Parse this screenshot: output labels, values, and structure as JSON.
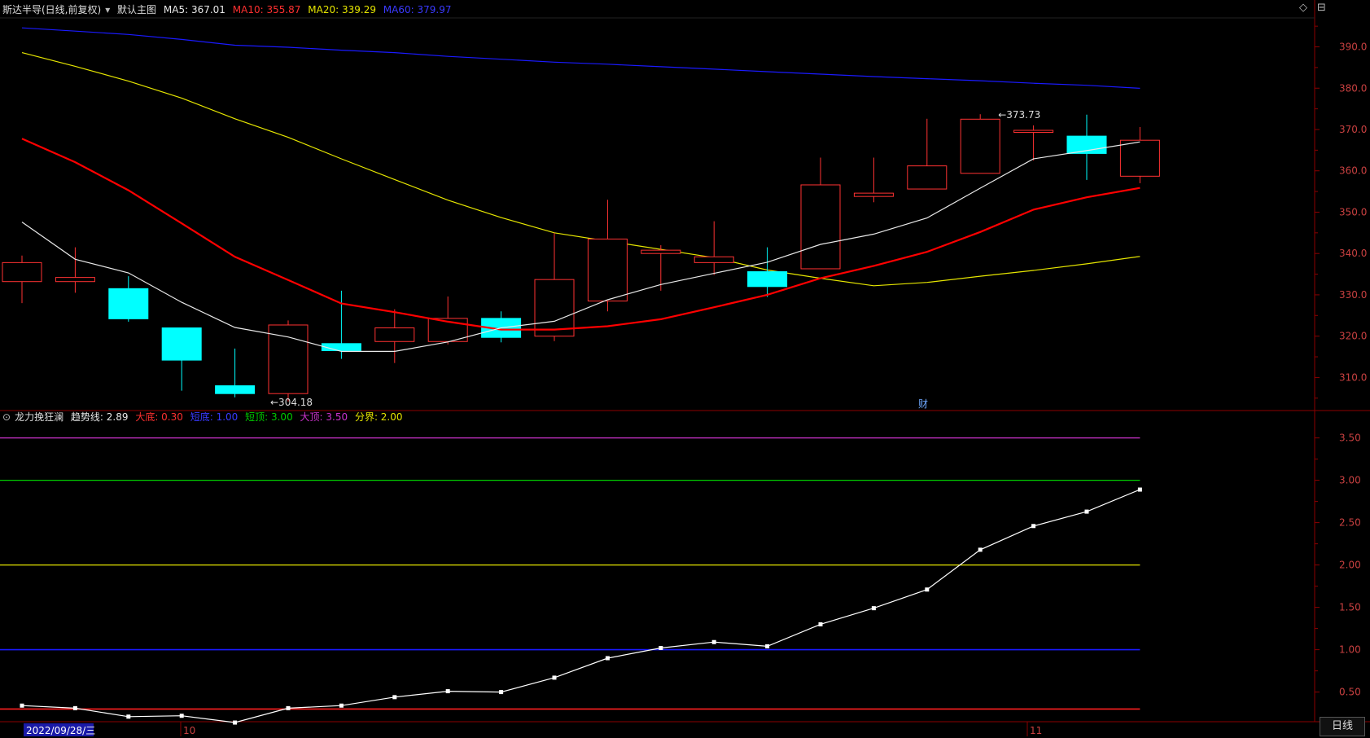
{
  "colors": {
    "up": "#ff3232",
    "down": "#00ffff",
    "ma5": "#e8e8e8",
    "ma10": "#ff0000",
    "ma20": "#e5e500",
    "ma60": "#1a1aff",
    "frame": "#8b0000",
    "axis_text": "#c84040",
    "trend": "#ffffff"
  },
  "main_header": {
    "title": "斯达半导(日线,前复权)",
    "mode": "默认主图",
    "ma5": "MA5: 367.01",
    "ma10": "MA10: 355.87",
    "ma20": "MA20: 339.29",
    "ma60": "MA60: 379.97"
  },
  "sub_header": {
    "title": "龙力挽狂澜",
    "trend": "趋势线: 2.89",
    "bottom": "大底: 0.30",
    "short_bottom": "短底: 1.00",
    "short_top": "短顶: 3.00",
    "top": "大顶: 3.50",
    "divide": "分界: 2.00"
  },
  "top_controls": {
    "diamond": "◇",
    "minimize": "⊟"
  },
  "annotations": {
    "high": "373.73",
    "low": "304.18",
    "finance": "财"
  },
  "date_axis": {
    "cursor_date": "2022/09/28/三",
    "month_10": "10",
    "month_11": "11"
  },
  "period_button": "日线",
  "chart_data": [
    {
      "type": "candlestick",
      "yticks": [
        310,
        320,
        330,
        340,
        350,
        360,
        370,
        380,
        390
      ],
      "ylim": [
        302,
        397
      ],
      "candles": [
        {
          "open": 333.2,
          "high": 339.5,
          "low": 328.0,
          "close": 337.8
        },
        {
          "open": 333.2,
          "high": 341.5,
          "low": 330.5,
          "close": 334.2
        },
        {
          "open": 331.5,
          "high": 334.5,
          "low": 323.5,
          "close": 324.2
        },
        {
          "open": 322.0,
          "high": 322.0,
          "low": 306.8,
          "close": 314.2
        },
        {
          "open": 308.0,
          "high": 317.0,
          "low": 305.2,
          "close": 306.1
        },
        {
          "open": 306.1,
          "high": 323.8,
          "low": 304.2,
          "close": 322.7
        },
        {
          "open": 318.2,
          "high": 331.0,
          "low": 314.5,
          "close": 316.5
        },
        {
          "open": 318.7,
          "high": 326.5,
          "low": 313.5,
          "close": 322.0
        },
        {
          "open": 318.7,
          "high": 329.6,
          "low": 318.0,
          "close": 324.3
        },
        {
          "open": 324.3,
          "high": 326.0,
          "low": 318.5,
          "close": 319.7
        },
        {
          "open": 320.0,
          "high": 345.0,
          "low": 318.8,
          "close": 333.7
        },
        {
          "open": 328.5,
          "high": 353.0,
          "low": 326.0,
          "close": 343.5
        },
        {
          "open": 340.0,
          "high": 342.0,
          "low": 331.0,
          "close": 340.8
        },
        {
          "open": 337.8,
          "high": 347.8,
          "low": 334.8,
          "close": 339.2
        },
        {
          "open": 335.6,
          "high": 341.5,
          "low": 329.5,
          "close": 332.0
        },
        {
          "open": 336.3,
          "high": 363.2,
          "low": 336.3,
          "close": 356.6
        },
        {
          "open": 353.8,
          "high": 363.2,
          "low": 352.4,
          "close": 354.6
        },
        {
          "open": 355.6,
          "high": 372.6,
          "low": 355.6,
          "close": 361.2
        },
        {
          "open": 359.4,
          "high": 373.7,
          "low": 359.4,
          "close": 372.5
        },
        {
          "open": 369.3,
          "high": 371.0,
          "low": 362.5,
          "close": 369.8
        },
        {
          "open": 368.4,
          "high": 373.6,
          "low": 357.8,
          "close": 364.2
        },
        {
          "open": 358.7,
          "high": 370.6,
          "low": 357.0,
          "close": 367.4
        }
      ],
      "ma5": [
        347.6,
        338.6,
        335.3,
        328.2,
        322.1,
        319.8,
        316.3,
        316.3,
        318.6,
        322.0,
        323.6,
        328.8,
        332.5,
        335.2,
        337.9,
        342.2,
        344.7,
        348.6,
        355.8,
        362.9,
        364.9,
        367.01
      ],
      "ma10": [
        367.8,
        362.1,
        355.3,
        347.3,
        339.2,
        333.6,
        327.9,
        325.8,
        323.5,
        321.6,
        321.6,
        322.4,
        324.1,
        327.0,
        330.0,
        334.0,
        337.0,
        340.4,
        345.2,
        350.6,
        353.6,
        355.87
      ],
      "ma20": [
        388.6,
        385.3,
        381.7,
        377.6,
        372.6,
        368.1,
        362.9,
        357.9,
        352.9,
        348.7,
        345.0,
        343.0,
        341.0,
        339.0,
        336.0,
        334.0,
        332.2,
        333.0,
        334.5,
        335.9,
        337.5,
        339.29
      ],
      "ma60": [
        394.6,
        393.8,
        393.0,
        391.8,
        390.4,
        389.9,
        389.2,
        388.6,
        387.7,
        387.0,
        386.3,
        385.8,
        385.2,
        384.6,
        384.0,
        383.4,
        382.8,
        382.3,
        381.8,
        381.2,
        380.7,
        379.97
      ]
    },
    {
      "type": "line",
      "name": "趋势线",
      "yticks": [
        0.5,
        1.0,
        1.5,
        2.0,
        2.5,
        3.0,
        3.5
      ],
      "ylim": [
        0.15,
        3.65
      ],
      "values": [
        0.34,
        0.31,
        0.21,
        0.22,
        0.14,
        0.31,
        0.34,
        0.44,
        0.51,
        0.5,
        0.67,
        0.9,
        1.02,
        1.09,
        1.04,
        1.3,
        1.49,
        1.71,
        2.18,
        2.46,
        2.63,
        2.89
      ],
      "levels": [
        {
          "value": 0.3,
          "color": "#ff2020"
        },
        {
          "value": 1.0,
          "color": "#1a1aff"
        },
        {
          "value": 2.0,
          "color": "#e5e500"
        },
        {
          "value": 3.0,
          "color": "#00cc00"
        },
        {
          "value": 3.5,
          "color": "#cc33cc"
        }
      ]
    }
  ]
}
